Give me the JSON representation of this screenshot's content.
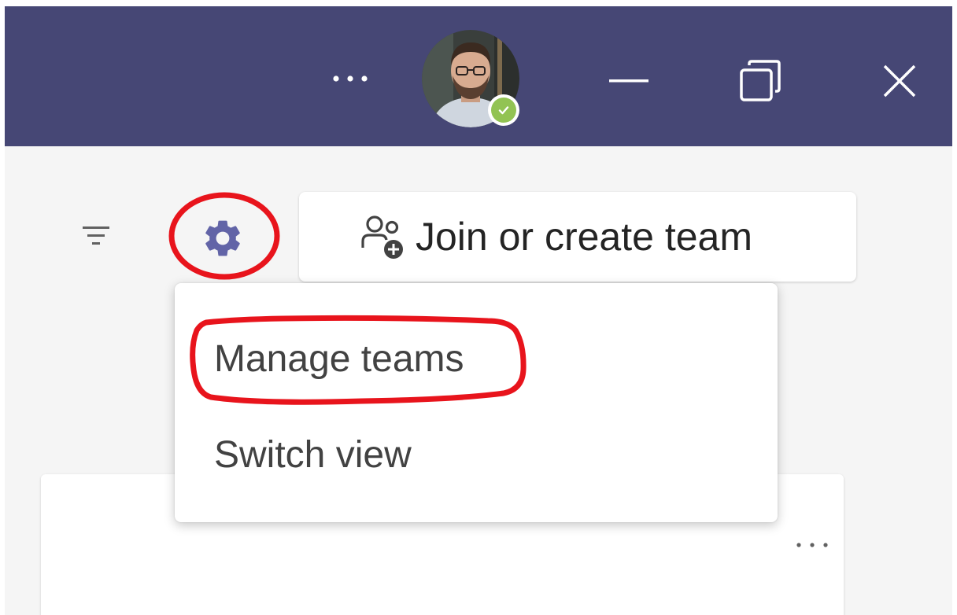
{
  "titlebar": {
    "background": "#464775",
    "more_icon": "more-horizontal-icon",
    "avatar_status": "available",
    "status_color": "#92c353",
    "minimize_icon": "minimize-icon",
    "restore_icon": "restore-icon",
    "close_icon": "close-icon"
  },
  "toolbar": {
    "filter_icon": "filter-icon",
    "settings_icon": "gear-icon",
    "accent_color": "#6264a7",
    "join_button_label": "Join or create team",
    "join_icon": "people-add-icon"
  },
  "menu": {
    "items": [
      {
        "label": "Manage teams",
        "highlighted": true
      },
      {
        "label": "Switch view",
        "highlighted": false
      }
    ]
  },
  "team_card": {
    "more_icon": "more-horizontal-icon"
  },
  "annotation": {
    "marker_color": "#e8141c"
  }
}
